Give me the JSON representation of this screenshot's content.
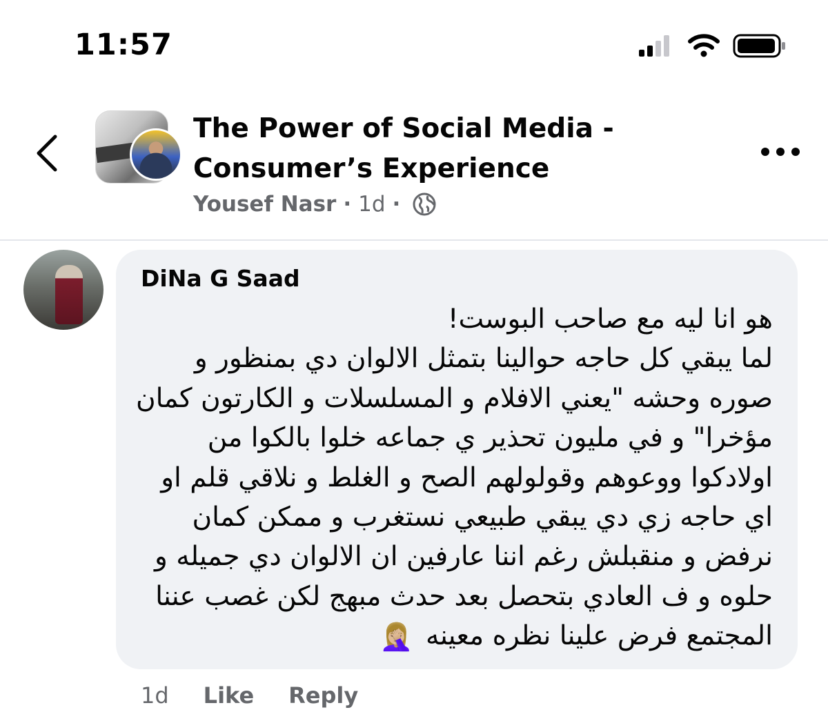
{
  "status_bar": {
    "time": "11:57",
    "icons": [
      "cellular-signal-icon",
      "wifi-icon",
      "battery-icon"
    ]
  },
  "header": {
    "back_icon": "chevron-left-icon",
    "group_title": "The Power of Social Media - Consumer’s Experience",
    "author": "Yousef Nasr",
    "separator": "·",
    "time": "1d",
    "privacy_icon": "globe-icon",
    "more_icon": "more-dots-icon"
  },
  "comment": {
    "author": "DiNa G Saad",
    "text": "هو انا ليه مع صاحب البوست!\nلما يبقي كل حاجه حوالينا بتمثل الالوان دي بمنظور و صوره وحشه \"يعني الافلام و المسلسلات و الكارتون كمان مؤخرا\" و في مليون تحذير ي جماعه خلوا بالكوا من اولادكوا ووعوهم وقولولهم الصح و الغلط و نلاقي قلم او اي حاجه زي دي يبقي طبيعي نستغرب و ممكن كمان نرفض و منقبلش رغم اننا عارفين ان الالوان دي جميله و حلوه و ف العادي بتحصل بعد حدث مبهج لكن غصب عننا المجتمع فرض علينا نظره معينه",
    "emoji": "🤦🏼‍♀️",
    "emoji_icon": "face-palm-emoji-icon",
    "age": "1d",
    "like_label": "Like",
    "reply_label": "Reply"
  },
  "colors": {
    "background": "#ffffff",
    "bubble": "#f0f2f5",
    "secondary_text": "#65676b",
    "primary_text": "#050505",
    "divider": "#e4e6eb"
  }
}
